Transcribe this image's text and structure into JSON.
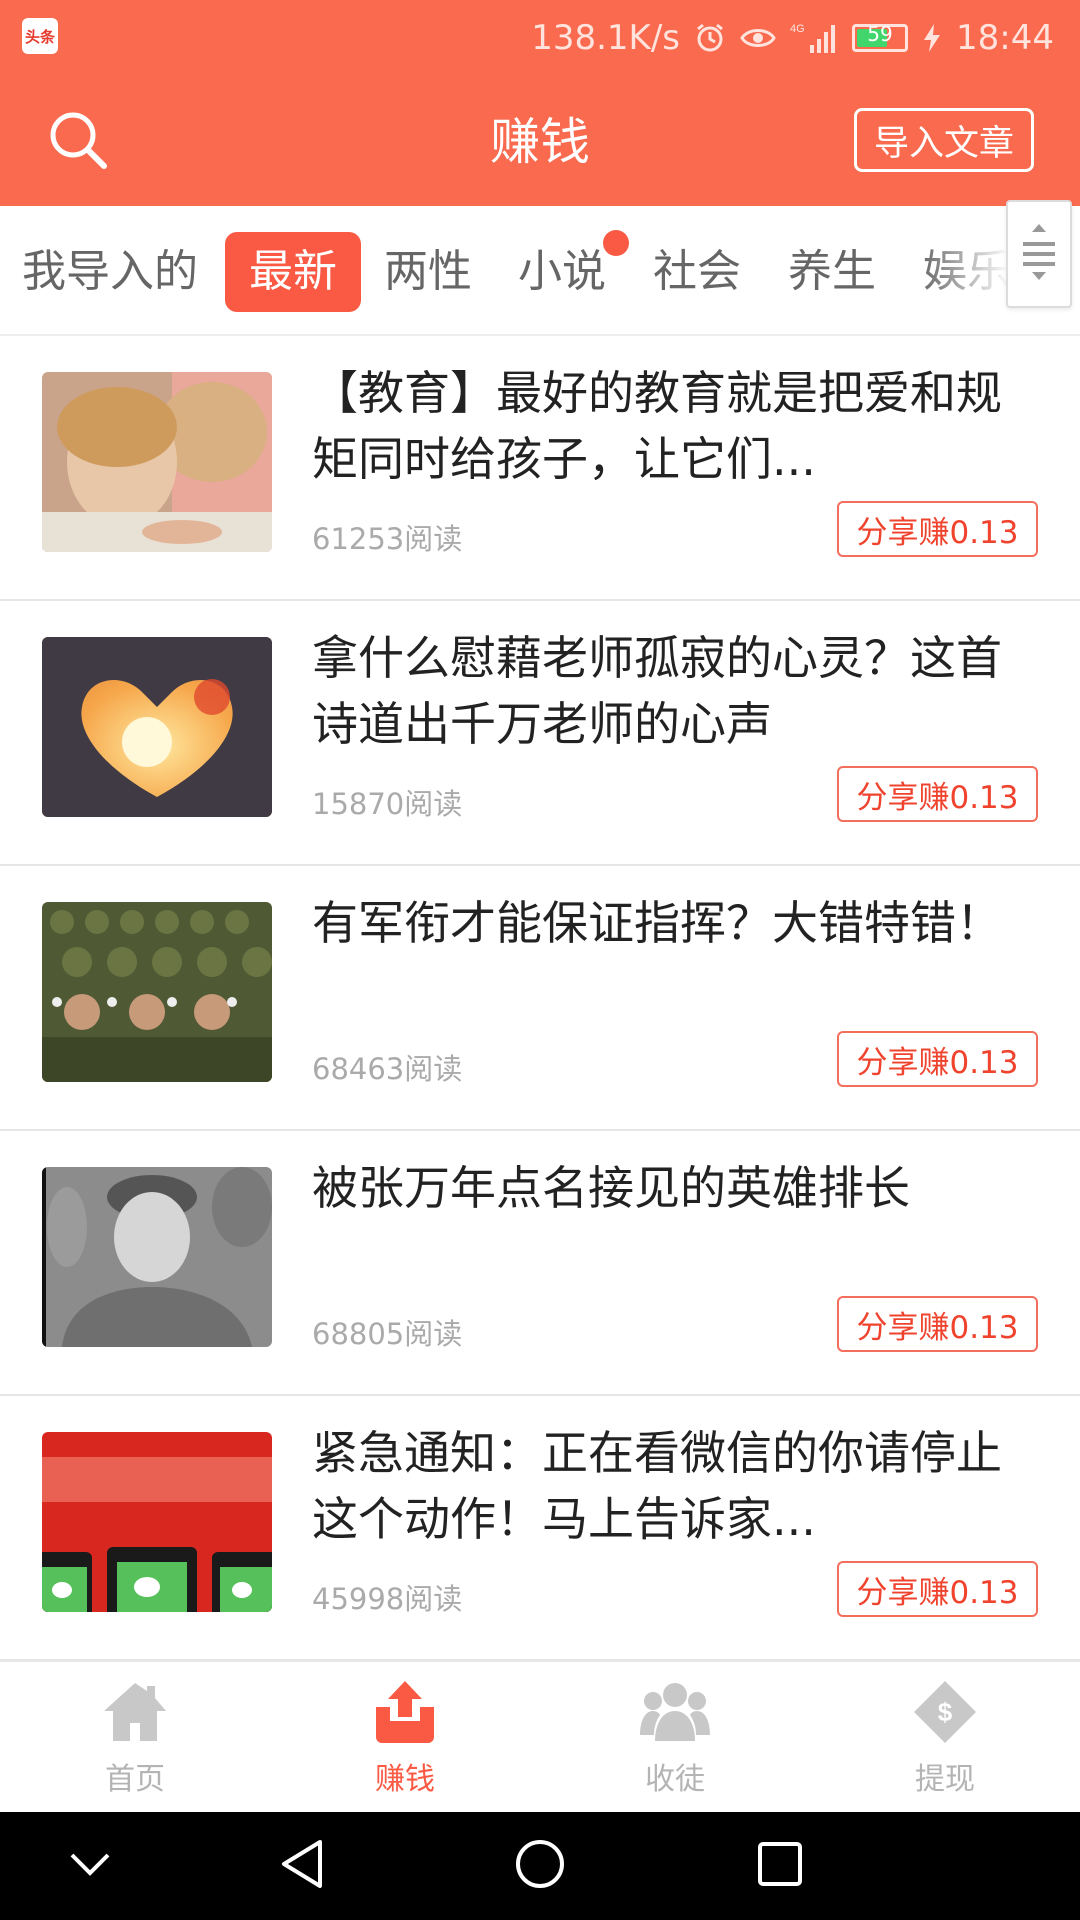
{
  "status_bar": {
    "app_badge": "头条",
    "network_speed": "138.1K/s",
    "network_type": "4G",
    "battery": "59",
    "time": "18:44"
  },
  "header": {
    "title": "赚钱",
    "import_button": "导入文章",
    "search_icon": "search-icon"
  },
  "tabs": [
    {
      "label": "我导入的",
      "active": false
    },
    {
      "label": "最新",
      "active": true
    },
    {
      "label": "两性",
      "active": false
    },
    {
      "label": "小说",
      "active": false,
      "dot": true
    },
    {
      "label": "社会",
      "active": false
    },
    {
      "label": "养生",
      "active": false
    },
    {
      "label": "娱乐",
      "active": false
    }
  ],
  "articles": [
    {
      "title": "【教育】最好的教育就是把爱和规矩同时给孩子，让它们...",
      "reads": "61253阅读",
      "share": "分享赚0.13"
    },
    {
      "title": "拿什么慰藉老师孤寂的心灵？这首诗道出千万老师的心声",
      "reads": "15870阅读",
      "share": "分享赚0.13"
    },
    {
      "title": "有军衔才能保证指挥？大错特错！",
      "reads": "68463阅读",
      "share": "分享赚0.13"
    },
    {
      "title": "被张万年点名接见的英雄排长",
      "reads": "68805阅读",
      "share": "分享赚0.13"
    },
    {
      "title": "紧急通知：正在看微信的你请停止这个动作！马上告诉家...",
      "reads": "45998阅读",
      "share": "分享赚0.13"
    }
  ],
  "bottom_nav": [
    {
      "label": "首页",
      "icon": "home-icon",
      "active": false
    },
    {
      "label": "赚钱",
      "icon": "upload-earn-icon",
      "active": true
    },
    {
      "label": "收徒",
      "icon": "people-icon",
      "active": false
    },
    {
      "label": "提现",
      "icon": "withdraw-icon",
      "active": false
    }
  ],
  "colors": {
    "brand": "#fa6a4f",
    "accent": "#fa5a44",
    "inactive": "#b4b4b4"
  }
}
